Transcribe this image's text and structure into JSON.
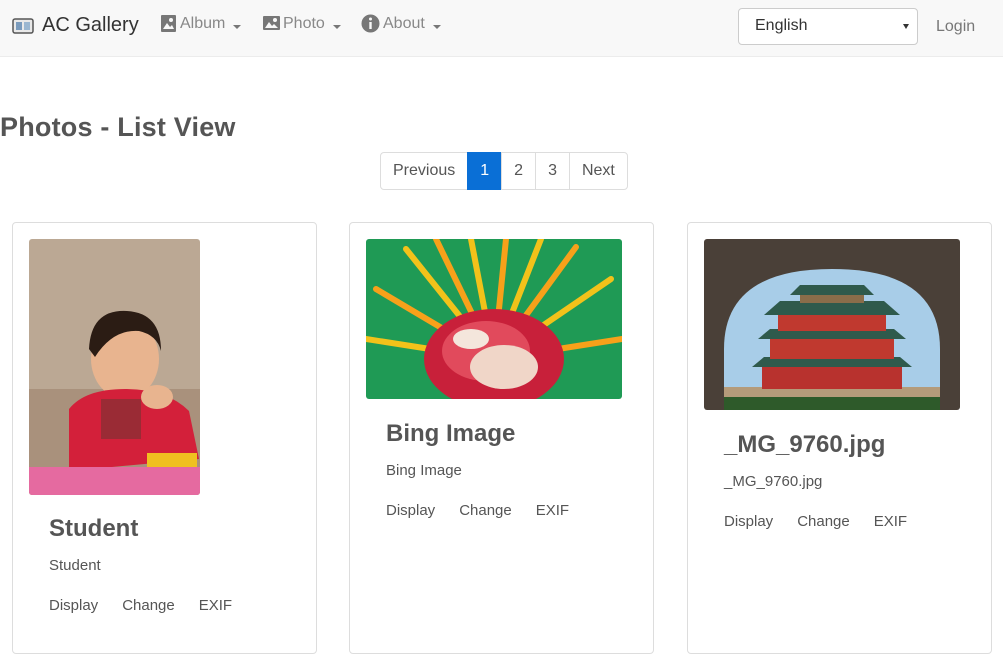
{
  "navbar": {
    "brand": "AC Gallery",
    "menus": [
      {
        "label": "Album",
        "icon": "image-icon"
      },
      {
        "label": "Photo",
        "icon": "picture-icon"
      },
      {
        "label": "About",
        "icon": "info-icon"
      }
    ],
    "language": "English",
    "login": "Login"
  },
  "page": {
    "title": "Photos - List View"
  },
  "pagination": {
    "previous": "Previous",
    "pages": [
      "1",
      "2",
      "3"
    ],
    "active": "1",
    "next": "Next"
  },
  "cards": [
    {
      "title": "Student",
      "subtitle": "Student",
      "actions": [
        "Display",
        "Change",
        "EXIF"
      ]
    },
    {
      "title": "Bing Image",
      "subtitle": "Bing Image",
      "actions": [
        "Display",
        "Change",
        "EXIF"
      ]
    },
    {
      "title": "_MG_9760.jpg",
      "subtitle": "_MG_9760.jpg",
      "actions": [
        "Display",
        "Change",
        "EXIF"
      ]
    }
  ],
  "colors": {
    "navbar_bg": "#f8f8f8",
    "active_page": "#0a6fd6"
  }
}
